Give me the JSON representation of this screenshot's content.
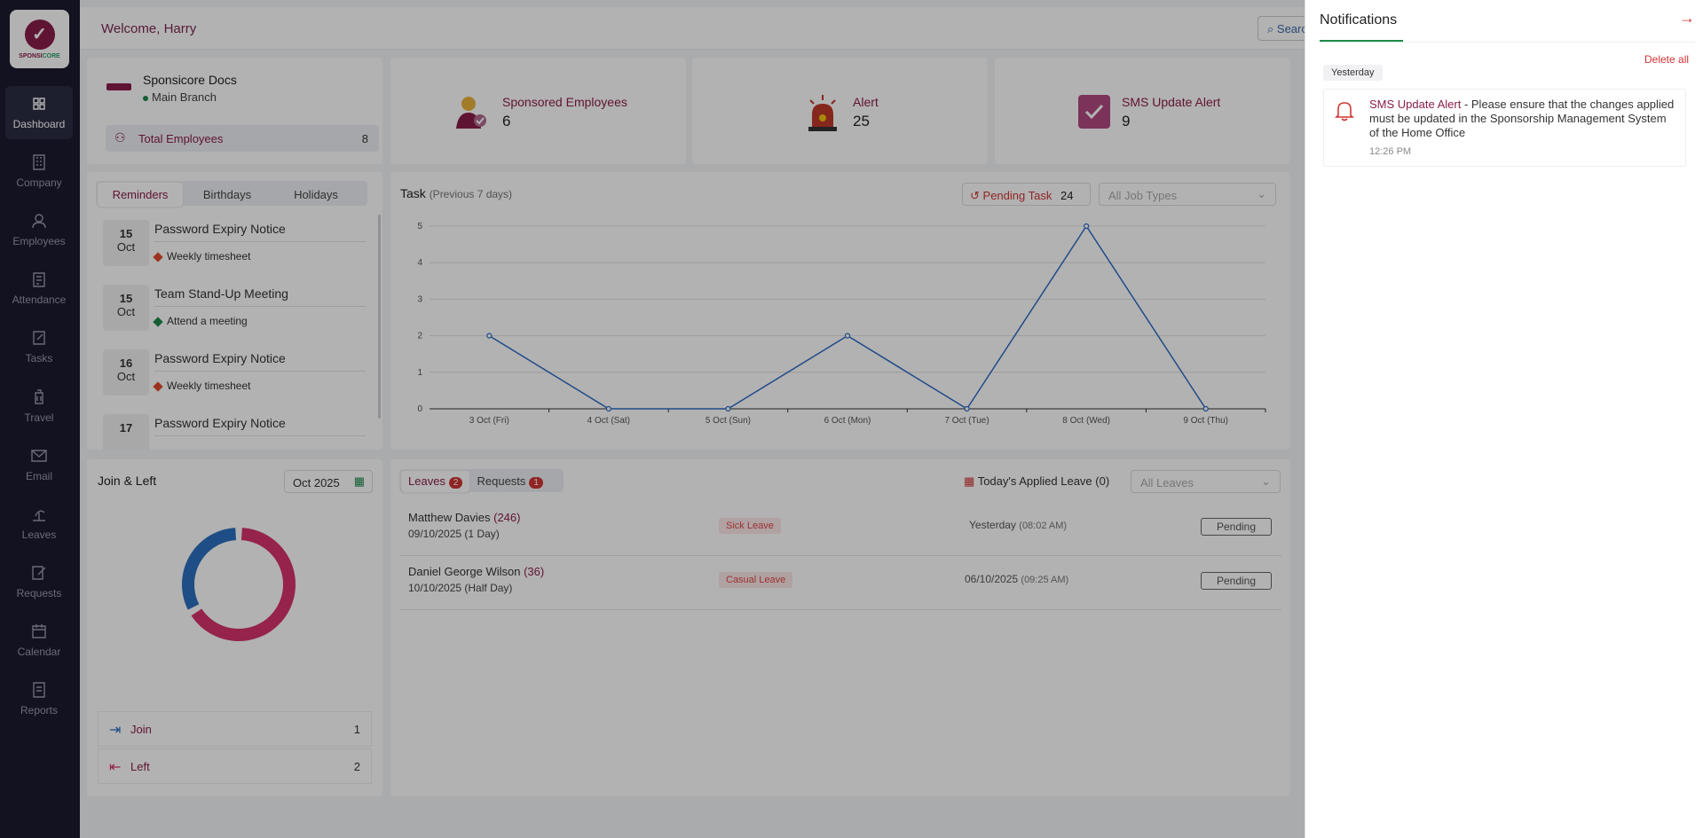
{
  "app": {
    "logo_text_a": "SPONSI",
    "logo_text_b": "CORE"
  },
  "sidebar": {
    "items": [
      {
        "label": "Dashboard",
        "icon": "grid-icon",
        "active": true
      },
      {
        "label": "Company",
        "icon": "building-icon"
      },
      {
        "label": "Employees",
        "icon": "user-icon"
      },
      {
        "label": "Attendance",
        "icon": "clipboard-icon"
      },
      {
        "label": "Tasks",
        "icon": "edit-icon"
      },
      {
        "label": "Travel",
        "icon": "luggage-icon"
      },
      {
        "label": "Email",
        "icon": "mail-icon"
      },
      {
        "label": "Leaves",
        "icon": "beach-icon"
      },
      {
        "label": "Requests",
        "icon": "pen-icon"
      },
      {
        "label": "Calendar",
        "icon": "calendar-icon"
      },
      {
        "label": "Reports",
        "icon": "report-icon"
      }
    ]
  },
  "header": {
    "welcome": "Welcome, Harry",
    "search_label": "Search"
  },
  "company": {
    "name": "Sponsicore Docs",
    "branch": "Main Branch",
    "total_label": "Total Employees",
    "total_value": "8"
  },
  "stats": [
    {
      "label": "Sponsored Employees",
      "value": "6"
    },
    {
      "label": "Alert",
      "value": "25"
    },
    {
      "label": "SMS Update Alert",
      "value": "9"
    }
  ],
  "reminders": {
    "tabs": [
      "Reminders",
      "Birthdays",
      "Holidays"
    ],
    "items": [
      {
        "day": "15",
        "month": "Oct",
        "title": "Password Expiry Notice",
        "sub": "Weekly timesheet",
        "color": "#e0492f"
      },
      {
        "day": "15",
        "month": "Oct",
        "title": "Team Stand-Up Meeting",
        "sub": "Attend a meeting",
        "color": "#1d8a4a"
      },
      {
        "day": "16",
        "month": "Oct",
        "title": "Password Expiry Notice",
        "sub": "Weekly timesheet",
        "color": "#e0492f"
      },
      {
        "day": "17",
        "month": "",
        "title": "Password Expiry Notice",
        "sub": "",
        "color": "#e0492f"
      }
    ]
  },
  "task": {
    "title": "Task",
    "subtitle": "(Previous 7 days)",
    "pending_label": "Pending Task",
    "pending_count": "24",
    "job_types_placeholder": "All Job Types"
  },
  "chart_data": {
    "type": "line",
    "categories": [
      "3 Oct (Fri)",
      "4 Oct (Sat)",
      "5 Oct (Sun)",
      "6 Oct (Mon)",
      "7 Oct (Tue)",
      "8 Oct (Wed)",
      "9 Oct (Thu)"
    ],
    "values": [
      2,
      0,
      0,
      2,
      0,
      5,
      0
    ],
    "ylim": [
      0,
      5
    ],
    "yticks": [
      "0",
      "1",
      "2",
      "3",
      "4",
      "5"
    ],
    "color": "#2f6bc4",
    "grid": true
  },
  "join_left": {
    "title": "Join & Left",
    "month": "Oct 2025",
    "join_label": "Join",
    "join_value": "1",
    "left_label": "Left",
    "left_value": "2",
    "donut": [
      {
        "name": "Join",
        "value": 1,
        "color": "#2d6fbf"
      },
      {
        "name": "Left",
        "value": 2,
        "color": "#d6336c"
      }
    ]
  },
  "leaves": {
    "tab_leaves": "Leaves",
    "tab_leaves_count": "2",
    "tab_requests": "Requests",
    "tab_requests_count": "1",
    "today_label": "Today's Applied Leave",
    "today_count": "(0)",
    "filter_placeholder": "All Leaves",
    "rows": [
      {
        "name": "Matthew Davies",
        "id": "(246)",
        "date": "09/10/2025 (1 Day)",
        "type": "Sick Leave",
        "applied": "Yesterday",
        "time": "(08:02 AM)",
        "status": "Pending"
      },
      {
        "name": "Daniel George Wilson",
        "id": "(36)",
        "date": "10/10/2025 (Half Day)",
        "type": "Casual Leave",
        "applied": "06/10/2025",
        "time": "(09:25 AM)",
        "status": "Pending"
      }
    ]
  },
  "notifications": {
    "title": "Notifications",
    "delete_all": "Delete all",
    "group": "Yesterday",
    "items": [
      {
        "title": "SMS Update Alert",
        "body": " - Please ensure that the changes applied must be updated in the Sponsorship Management System of the Home Office",
        "time": "12:26 PM"
      }
    ]
  }
}
